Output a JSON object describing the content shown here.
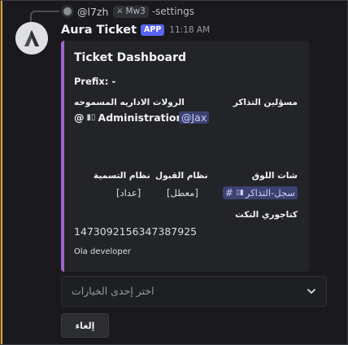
{
  "reply": {
    "user": "@l7zh",
    "role_badge": "Mw3",
    "text": "-settings"
  },
  "message": {
    "username": "Aura Ticket",
    "app_badge": "APP",
    "timestamp": "11:18 AM"
  },
  "embed": {
    "accent_color": "#a064ce",
    "title": "Ticket Dashboard",
    "prefix_line": "Prefix: -",
    "fields": {
      "ticket_managers": {
        "name": "مسؤلين التذاكر",
        "value": "@Jax"
      },
      "allowed_admin_roles": {
        "name": "الرولات الاداريه المسموحه",
        "value": "Administration",
        "prefix": "@"
      },
      "log_channel": {
        "name": "شات اللوق",
        "value": "سجل-التذاكر"
      },
      "accept_system": {
        "name": "نظام القبول",
        "value": "[معطل]"
      },
      "naming_system": {
        "name": "نظام التسمية",
        "value": "[عداد]"
      },
      "ticket_category": {
        "name": "كتاجوري التكت",
        "value": "1473092156347387925"
      }
    },
    "footer": "Ola developer"
  },
  "select_menu": {
    "placeholder": "اختر إحدى الخيارات"
  },
  "buttons": {
    "cancel_label": "إلغاء"
  },
  "icons": {
    "reply_avatar": "user-avatar-icon",
    "role_badge": "sword-icon",
    "role_mention": "server-role-icon",
    "channel_hash": "hash-icon",
    "chevron": "chevron-down-icon",
    "bot_avatar": "aura-logo-icon"
  }
}
